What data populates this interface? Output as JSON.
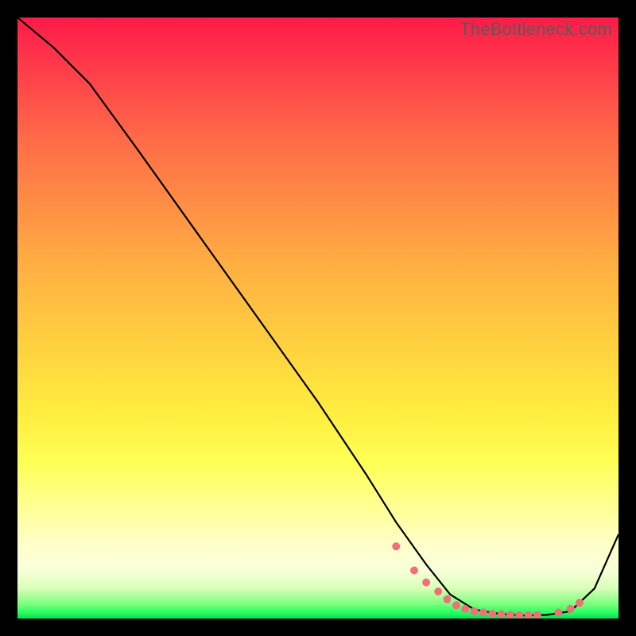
{
  "attribution": "TheBottleneck.com",
  "chart_data": {
    "type": "line",
    "title": "",
    "xlabel": "",
    "ylabel": "",
    "xlim": [
      0,
      100
    ],
    "ylim": [
      0,
      100
    ],
    "grid": false,
    "legend": false,
    "series": [
      {
        "name": "curve",
        "color": "#000000",
        "x": [
          0,
          6,
          12,
          20,
          30,
          40,
          50,
          58,
          63,
          68,
          72,
          76,
          80,
          84,
          88,
          92,
          96,
          100
        ],
        "y": [
          100,
          95,
          89,
          78,
          64,
          50,
          36,
          24,
          16,
          9,
          4,
          1.5,
          0.8,
          0.5,
          0.6,
          1.2,
          5,
          14
        ]
      }
    ],
    "markers": {
      "name": "dotted-trough",
      "color": "#f07078",
      "radius_px": 5,
      "x": [
        63,
        66,
        68,
        70,
        71.5,
        73,
        74.5,
        76,
        77.5,
        79,
        80.5,
        82,
        83.5,
        85,
        86.5,
        90,
        92,
        93.5
      ],
      "y": [
        12,
        8,
        6,
        4.5,
        3.2,
        2.2,
        1.6,
        1.2,
        1.0,
        0.8,
        0.7,
        0.6,
        0.55,
        0.55,
        0.6,
        1.0,
        1.6,
        2.6
      ]
    }
  }
}
